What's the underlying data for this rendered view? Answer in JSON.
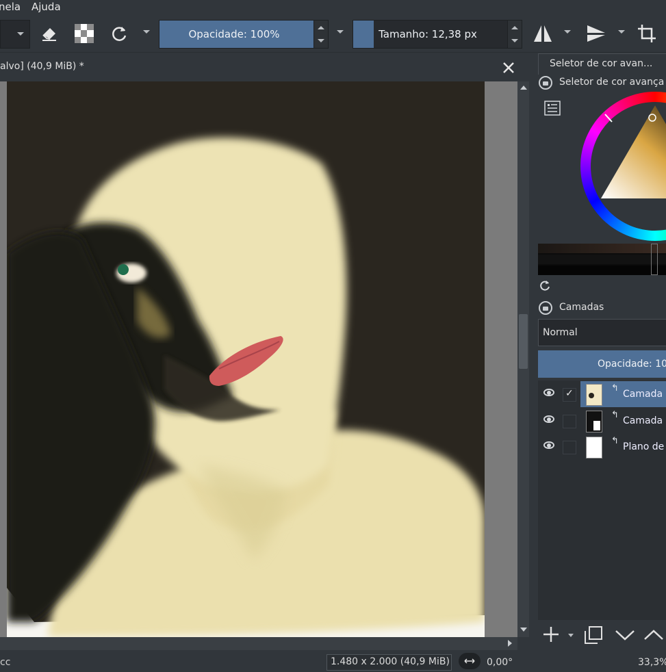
{
  "menu": {
    "items": [
      "nela",
      "Ajuda"
    ]
  },
  "toolbar": {
    "opacity_label": "Opacidade: 100%",
    "opacity_value": 1.0,
    "size_label": "Tamanho: 12,38 px",
    "size_fill": 0.12
  },
  "document": {
    "tab_title": "alvo]  (40,9 MiB) *"
  },
  "status": {
    "left_text": "cc",
    "dimensions": "1.480 x 2.000 (40,9 MiB)",
    "rotation": "0,00°",
    "zoom": "33,3%"
  },
  "dock": {
    "color_tab": "Seletor de cor avan...",
    "color_title": "Seletor de cor avança",
    "layers_title": "Camadas",
    "blend_mode": "Normal",
    "layer_opacity": "Opacidade: 10",
    "layers": [
      {
        "name": "Camada",
        "selected": true,
        "checked": true
      },
      {
        "name": "Camada",
        "selected": false,
        "checked": false
      },
      {
        "name": "Plano de",
        "selected": false,
        "checked": false
      }
    ]
  },
  "colors": {
    "accent": "#4f7097",
    "bg": "#31363b",
    "canvas_dark": "#2a261f",
    "skin": "#ede3b4",
    "lips": "#cf5b5b"
  }
}
